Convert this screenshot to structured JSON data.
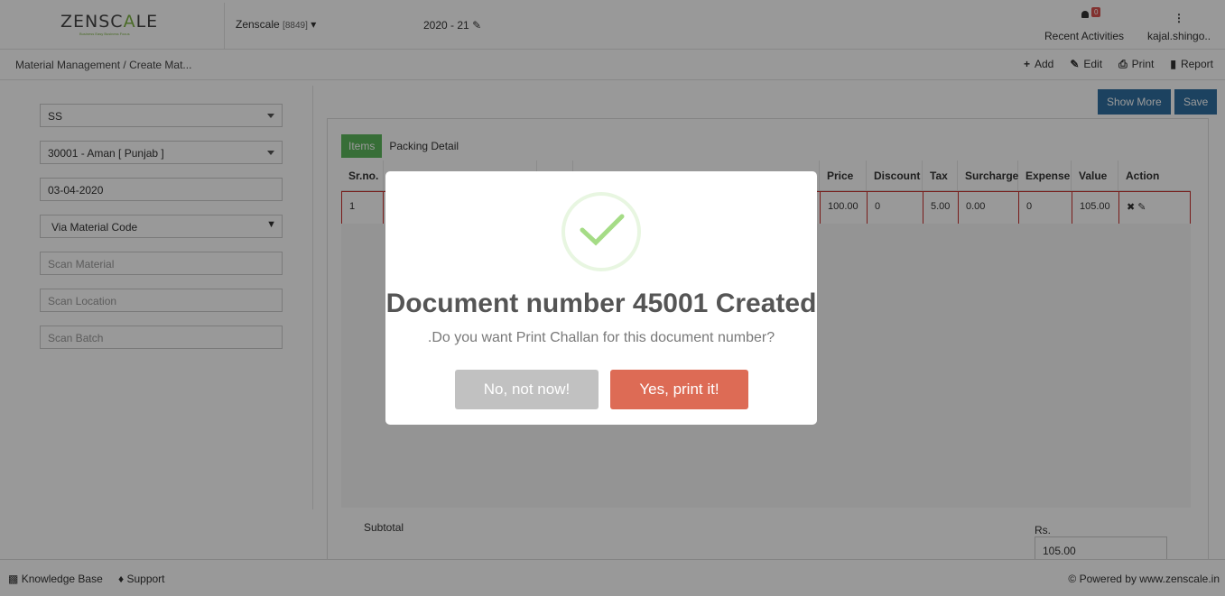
{
  "header": {
    "logo_prefix": "ZENSC",
    "logo_mid": "A",
    "logo_suffix": "LE",
    "logo_tagline": "Business Easy Business Focus",
    "company": "Zenscale",
    "company_code": "[8849]",
    "financial_year": "2020 - 21",
    "notification_count": "0",
    "recent_label": "Recent Activities",
    "user": "kajal.shingo.."
  },
  "breadcrumb": {
    "root": "Material Management",
    "current": "/ Create Mat..."
  },
  "actions": {
    "add": "Add",
    "edit": "Edit",
    "print": "Print",
    "report": "Report"
  },
  "form": {
    "type": "SS",
    "party": "30001 - Aman [ Punjab ]",
    "date": "03-04-2020",
    "mode": "Via Material Code",
    "scan_material": "Scan Material",
    "scan_location": "Scan Location",
    "scan_batch": "Scan Batch"
  },
  "buttons": {
    "show_more": "Show More",
    "save": "Save"
  },
  "tabs": {
    "items": "Items",
    "packing": "Packing Detail"
  },
  "table": {
    "headers": [
      "Sr.no.",
      "",
      "",
      "",
      "Price",
      "Discount",
      "Tax",
      "Surcharge",
      "Expense",
      "Value",
      "Action"
    ],
    "row": {
      "sr": "1",
      "price": "100.00",
      "discount": "0",
      "tax": "5.00",
      "surcharge": "0.00",
      "expense": "0",
      "value": "105.00"
    }
  },
  "totals": {
    "subtotal_label": "Subtotal",
    "currency": "Rs.",
    "subtotal_value": "105.00"
  },
  "footer": {
    "knowledge_base": "Knowledge Base",
    "support": "Support",
    "powered": "© Powered by www.zenscale.in"
  },
  "modal": {
    "title": "Document number 45001 Created",
    "text": ".Do you want Print Challan for this document number?",
    "cancel": "No, not now!",
    "confirm": "Yes, print it!",
    "success_color": "#a5dc86",
    "confirm_color": "#dd6b55"
  }
}
